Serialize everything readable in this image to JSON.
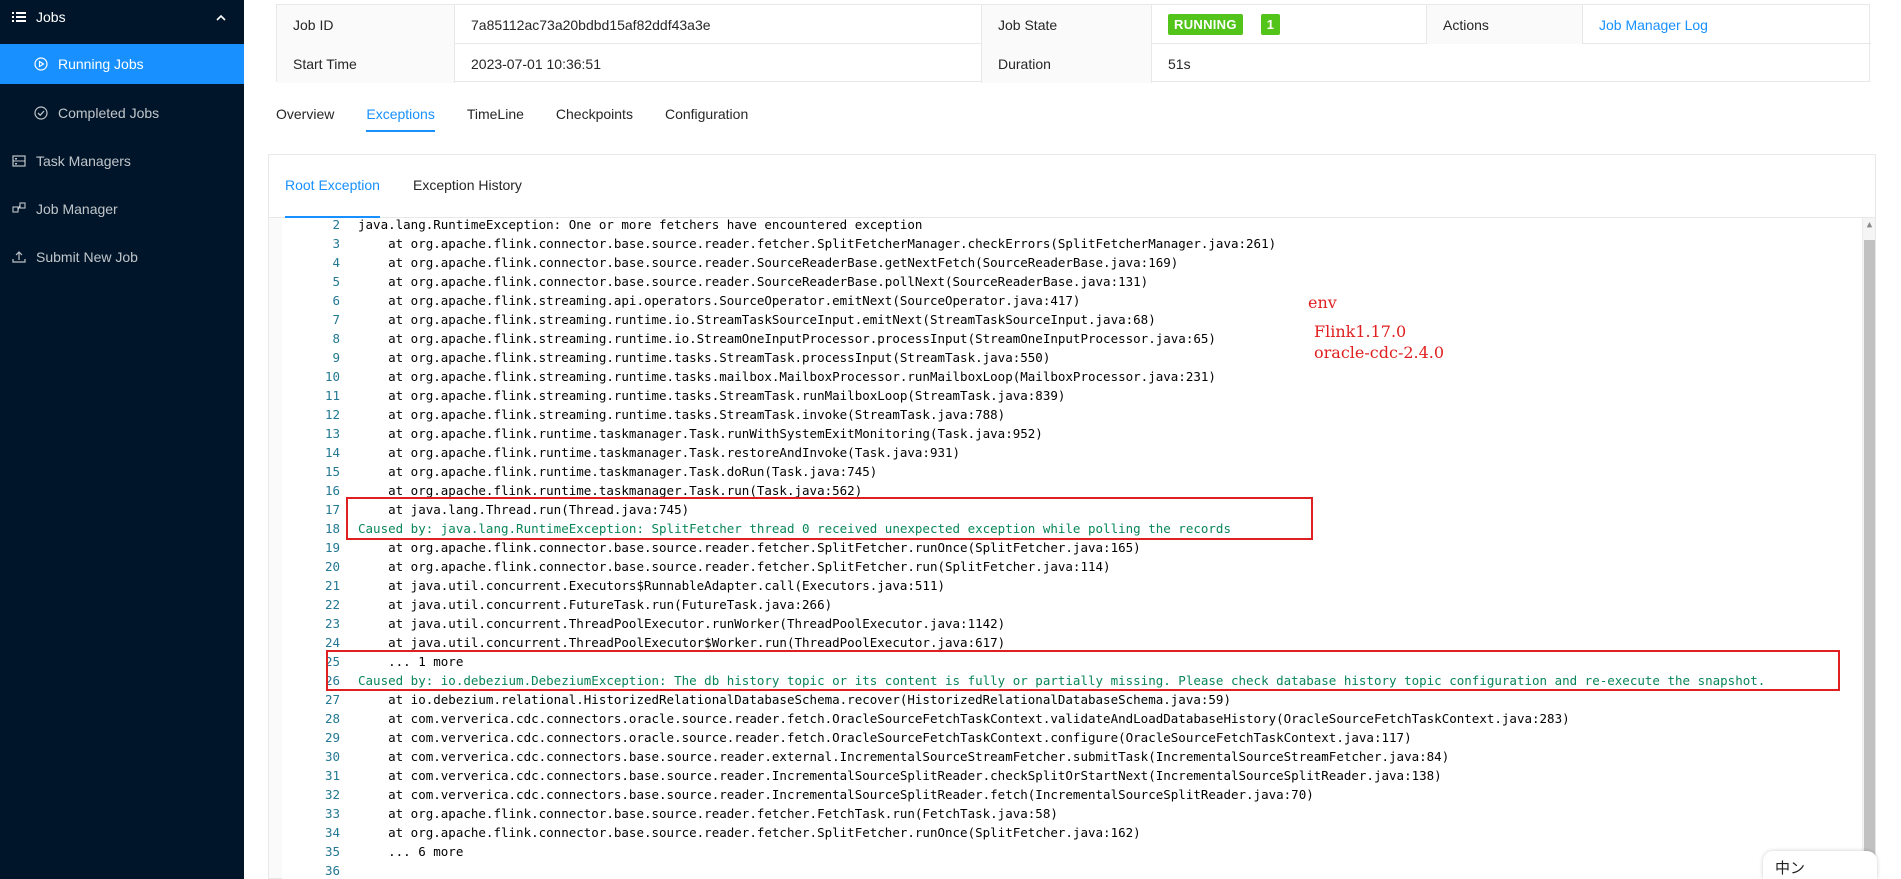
{
  "sidebar": {
    "section_label": "Jobs",
    "items": [
      {
        "label": "Running Jobs",
        "icon": "play-circle-icon",
        "selected": true
      },
      {
        "label": "Completed Jobs",
        "icon": "check-circle-icon",
        "selected": false
      }
    ],
    "top_items": [
      {
        "label": "Task Managers",
        "icon": "server-icon"
      },
      {
        "label": "Job Manager",
        "icon": "cluster-icon"
      },
      {
        "label": "Submit New Job",
        "icon": "upload-icon"
      }
    ]
  },
  "job": {
    "id_label": "Job ID",
    "id_value": "7a85112ac73a20bdbd15af82ddf43a3e",
    "state_label": "Job State",
    "state_value": "RUNNING",
    "running_count": "1",
    "actions_label": "Actions",
    "actions_link": "Job Manager Log",
    "start_label": "Start Time",
    "start_value": "2023-07-01 10:36:51",
    "duration_label": "Duration",
    "duration_value": "51s"
  },
  "tabs": [
    {
      "label": "Overview",
      "active": false
    },
    {
      "label": "Exceptions",
      "active": true
    },
    {
      "label": "TimeLine",
      "active": false
    },
    {
      "label": "Checkpoints",
      "active": false
    },
    {
      "label": "Configuration",
      "active": false
    }
  ],
  "subtabs": [
    {
      "label": "Root Exception",
      "active": true
    },
    {
      "label": "Exception History",
      "active": false
    }
  ],
  "colors": {
    "sidebar_bg": "#001529",
    "accent": "#1890ff",
    "running": "#52c41a",
    "annotation": "#e02020"
  },
  "code_lines": [
    {
      "n": "2",
      "t": "java.lang.RuntimeException: One or more fetchers have encountered exception"
    },
    {
      "n": "3",
      "t": "    at org.apache.flink.connector.base.source.reader.fetcher.SplitFetcherManager.checkErrors(SplitFetcherManager.java:261)"
    },
    {
      "n": "4",
      "t": "    at org.apache.flink.connector.base.source.reader.SourceReaderBase.getNextFetch(SourceReaderBase.java:169)"
    },
    {
      "n": "5",
      "t": "    at org.apache.flink.connector.base.source.reader.SourceReaderBase.pollNext(SourceReaderBase.java:131)"
    },
    {
      "n": "6",
      "t": "    at org.apache.flink.streaming.api.operators.SourceOperator.emitNext(SourceOperator.java:417)"
    },
    {
      "n": "7",
      "t": "    at org.apache.flink.streaming.runtime.io.StreamTaskSourceInput.emitNext(StreamTaskSourceInput.java:68)"
    },
    {
      "n": "8",
      "t": "    at org.apache.flink.streaming.runtime.io.StreamOneInputProcessor.processInput(StreamOneInputProcessor.java:65)"
    },
    {
      "n": "9",
      "t": "    at org.apache.flink.streaming.runtime.tasks.StreamTask.processInput(StreamTask.java:550)"
    },
    {
      "n": "10",
      "t": "    at org.apache.flink.streaming.runtime.tasks.mailbox.MailboxProcessor.runMailboxLoop(MailboxProcessor.java:231)"
    },
    {
      "n": "11",
      "t": "    at org.apache.flink.streaming.runtime.tasks.StreamTask.runMailboxLoop(StreamTask.java:839)"
    },
    {
      "n": "12",
      "t": "    at org.apache.flink.streaming.runtime.tasks.StreamTask.invoke(StreamTask.java:788)"
    },
    {
      "n": "13",
      "t": "    at org.apache.flink.runtime.taskmanager.Task.runWithSystemExitMonitoring(Task.java:952)"
    },
    {
      "n": "14",
      "t": "    at org.apache.flink.runtime.taskmanager.Task.restoreAndInvoke(Task.java:931)"
    },
    {
      "n": "15",
      "t": "    at org.apache.flink.runtime.taskmanager.Task.doRun(Task.java:745)"
    },
    {
      "n": "16",
      "t": "    at org.apache.flink.runtime.taskmanager.Task.run(Task.java:562)"
    },
    {
      "n": "17",
      "t": "    at java.lang.Thread.run(Thread.java:745)"
    },
    {
      "n": "18",
      "t": "Caused by: java.lang.RuntimeException: SplitFetcher thread 0 received unexpected exception while polling the records"
    },
    {
      "n": "19",
      "t": "    at org.apache.flink.connector.base.source.reader.fetcher.SplitFetcher.runOnce(SplitFetcher.java:165)"
    },
    {
      "n": "20",
      "t": "    at org.apache.flink.connector.base.source.reader.fetcher.SplitFetcher.run(SplitFetcher.java:114)"
    },
    {
      "n": "21",
      "t": "    at java.util.concurrent.Executors$RunnableAdapter.call(Executors.java:511)"
    },
    {
      "n": "22",
      "t": "    at java.util.concurrent.FutureTask.run(FutureTask.java:266)"
    },
    {
      "n": "23",
      "t": "    at java.util.concurrent.ThreadPoolExecutor.runWorker(ThreadPoolExecutor.java:1142)"
    },
    {
      "n": "24",
      "t": "    at java.util.concurrent.ThreadPoolExecutor$Worker.run(ThreadPoolExecutor.java:617)"
    },
    {
      "n": "25",
      "t": "    ... 1 more"
    },
    {
      "n": "26",
      "t": "Caused by: io.debezium.DebeziumException: The db history topic or its content is fully or partially missing. Please check database history topic configuration and re-execute the snapshot."
    },
    {
      "n": "27",
      "t": "    at io.debezium.relational.HistorizedRelationalDatabaseSchema.recover(HistorizedRelationalDatabaseSchema.java:59)"
    },
    {
      "n": "28",
      "t": "    at com.ververica.cdc.connectors.oracle.source.reader.fetch.OracleSourceFetchTaskContext.validateAndLoadDatabaseHistory(OracleSourceFetchTaskContext.java:283)"
    },
    {
      "n": "29",
      "t": "    at com.ververica.cdc.connectors.oracle.source.reader.fetch.OracleSourceFetchTaskContext.configure(OracleSourceFetchTaskContext.java:117)"
    },
    {
      "n": "30",
      "t": "    at com.ververica.cdc.connectors.base.source.reader.external.IncrementalSourceStreamFetcher.submitTask(IncrementalSourceStreamFetcher.java:84)"
    },
    {
      "n": "31",
      "t": "    at com.ververica.cdc.connectors.base.source.reader.IncrementalSourceSplitReader.checkSplitOrStartNext(IncrementalSourceSplitReader.java:138)"
    },
    {
      "n": "32",
      "t": "    at com.ververica.cdc.connectors.base.source.reader.IncrementalSourceSplitReader.fetch(IncrementalSourceSplitReader.java:70)"
    },
    {
      "n": "33",
      "t": "    at org.apache.flink.connector.base.source.reader.fetcher.FetchTask.run(FetchTask.java:58)"
    },
    {
      "n": "34",
      "t": "    at org.apache.flink.connector.base.source.reader.fetcher.SplitFetcher.runOnce(SplitFetcher.java:162)"
    },
    {
      "n": "35",
      "t": "    ... 6 more"
    },
    {
      "n": "36",
      "t": ""
    }
  ],
  "annotation": {
    "heading": "env",
    "lines": [
      "Flink1.17.0",
      "oracle-cdc-2.4.0"
    ]
  },
  "corner_widget_text": "中ン"
}
